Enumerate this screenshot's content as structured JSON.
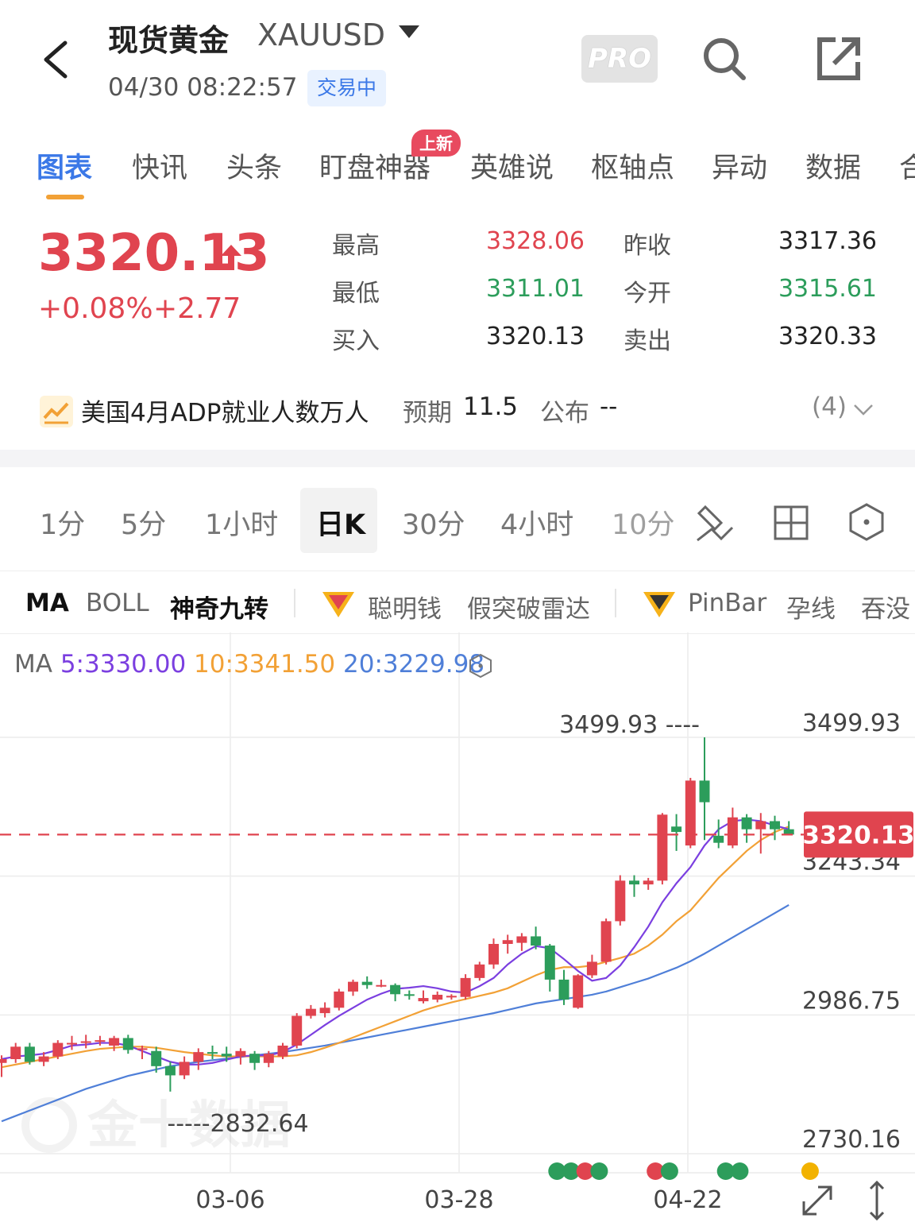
{
  "header": {
    "title": "现货黄金",
    "symbol": "XAUUSD",
    "datetime": "04/30 08:22:57",
    "status": "交易中",
    "pro_label": "PRO"
  },
  "tabs": [
    {
      "label": "图表"
    },
    {
      "label": "快讯"
    },
    {
      "label": "头条"
    },
    {
      "label": "盯盘神器",
      "badge": "上新"
    },
    {
      "label": "英雄说"
    },
    {
      "label": "枢轴点"
    },
    {
      "label": "异动"
    },
    {
      "label": "数据"
    },
    {
      "label": "合"
    }
  ],
  "quote": {
    "price": "3320.13",
    "change_pct": "+0.08%",
    "change": "+2.77",
    "high_label": "最高",
    "high": "3328.06",
    "prev_close_label": "昨收",
    "prev_close": "3317.36",
    "low_label": "最低",
    "low": "3311.01",
    "open_label": "今开",
    "open": "3315.61",
    "bid_label": "买入",
    "bid": "3320.13",
    "ask_label": "卖出",
    "ask": "3320.33"
  },
  "event": {
    "title": "美国4月ADP就业人数万人",
    "forecast_label": "预期",
    "forecast": "11.5",
    "actual_label": "公布",
    "actual": "--",
    "count": "(4)"
  },
  "periods": [
    "1分",
    "5分",
    "1小时",
    "日K",
    "30分",
    "4小时",
    "10分"
  ],
  "indicators": [
    "MA",
    "BOLL",
    "神奇九转",
    "聪明钱",
    "假突破雷达",
    "PinBar",
    "孕线",
    "吞没"
  ],
  "ma": {
    "label": "MA",
    "ma5": "5:3330.00",
    "ma10": "10:3341.50",
    "ma20": "20:3229.98",
    "colors": {
      "ma5": "#7b3fe0",
      "ma10": "#f2a136",
      "ma20": "#4f7fd8"
    }
  },
  "chart_data": {
    "type": "candlestick",
    "y_labels": [
      "3499.93",
      "3243.34",
      "2986.75",
      "2730.16"
    ],
    "ylim": [
      2730.16,
      3499.93
    ],
    "x_labels": [
      "03-06",
      "03-28",
      "04-22"
    ],
    "last_price_tag": "3320.13",
    "max_annotation": "3499.93",
    "min_annotation": "2832.64",
    "watermark": "金十数据",
    "colors": {
      "up": "#e0444f",
      "down": "#2c9d5b"
    },
    "candles": [
      {
        "o": 2898,
        "h": 2912,
        "l": 2872,
        "c": 2905
      },
      {
        "o": 2905,
        "h": 2935,
        "l": 2898,
        "c": 2928
      },
      {
        "o": 2928,
        "h": 2935,
        "l": 2895,
        "c": 2900
      },
      {
        "o": 2900,
        "h": 2918,
        "l": 2892,
        "c": 2910
      },
      {
        "o": 2910,
        "h": 2940,
        "l": 2905,
        "c": 2935
      },
      {
        "o": 2935,
        "h": 2948,
        "l": 2922,
        "c": 2935
      },
      {
        "o": 2935,
        "h": 2950,
        "l": 2925,
        "c": 2938
      },
      {
        "o": 2938,
        "h": 2948,
        "l": 2930,
        "c": 2940
      },
      {
        "o": 2930,
        "h": 2948,
        "l": 2920,
        "c": 2944
      },
      {
        "o": 2944,
        "h": 2950,
        "l": 2915,
        "c": 2922
      },
      {
        "o": 2922,
        "h": 2930,
        "l": 2905,
        "c": 2925
      },
      {
        "o": 2920,
        "h": 2928,
        "l": 2880,
        "c": 2892
      },
      {
        "o": 2892,
        "h": 2900,
        "l": 2845,
        "c": 2875
      },
      {
        "o": 2875,
        "h": 2910,
        "l": 2868,
        "c": 2900
      },
      {
        "o": 2900,
        "h": 2925,
        "l": 2885,
        "c": 2918
      },
      {
        "o": 2918,
        "h": 2930,
        "l": 2905,
        "c": 2915
      },
      {
        "o": 2915,
        "h": 2928,
        "l": 2900,
        "c": 2910
      },
      {
        "o": 2910,
        "h": 2925,
        "l": 2895,
        "c": 2920
      },
      {
        "o": 2915,
        "h": 2920,
        "l": 2885,
        "c": 2898
      },
      {
        "o": 2898,
        "h": 2920,
        "l": 2890,
        "c": 2915
      },
      {
        "o": 2910,
        "h": 2935,
        "l": 2905,
        "c": 2930
      },
      {
        "o": 2930,
        "h": 2990,
        "l": 2925,
        "c": 2985
      },
      {
        "o": 2985,
        "h": 3005,
        "l": 2980,
        "c": 2998
      },
      {
        "o": 2990,
        "h": 3010,
        "l": 2982,
        "c": 3000
      },
      {
        "o": 3000,
        "h": 3035,
        "l": 2995,
        "c": 3030
      },
      {
        "o": 3030,
        "h": 3052,
        "l": 3022,
        "c": 3048
      },
      {
        "o": 3048,
        "h": 3058,
        "l": 3035,
        "c": 3042
      },
      {
        "o": 3042,
        "h": 3052,
        "l": 3038,
        "c": 3042
      },
      {
        "o": 3042,
        "h": 3045,
        "l": 3012,
        "c": 3025
      },
      {
        "o": 3025,
        "h": 3032,
        "l": 3015,
        "c": 3022
      },
      {
        "o": 3012,
        "h": 3032,
        "l": 3008,
        "c": 3018
      },
      {
        "o": 3015,
        "h": 3030,
        "l": 3010,
        "c": 3024
      },
      {
        "o": 3020,
        "h": 3025,
        "l": 3015,
        "c": 3022
      },
      {
        "o": 3020,
        "h": 3062,
        "l": 3015,
        "c": 3055
      },
      {
        "o": 3055,
        "h": 3085,
        "l": 3050,
        "c": 3080
      },
      {
        "o": 3080,
        "h": 3128,
        "l": 3072,
        "c": 3118
      },
      {
        "o": 3118,
        "h": 3135,
        "l": 3100,
        "c": 3125
      },
      {
        "o": 3120,
        "h": 3138,
        "l": 3105,
        "c": 3132
      },
      {
        "o": 3132,
        "h": 3150,
        "l": 3108,
        "c": 3115
      },
      {
        "o": 3115,
        "h": 3118,
        "l": 3030,
        "c": 3052
      },
      {
        "o": 3052,
        "h": 3070,
        "l": 3005,
        "c": 3015
      },
      {
        "o": 3000,
        "h": 3062,
        "l": 2998,
        "c": 3060
      },
      {
        "o": 3060,
        "h": 3098,
        "l": 3055,
        "c": 3085
      },
      {
        "o": 3085,
        "h": 3165,
        "l": 3080,
        "c": 3160
      },
      {
        "o": 3160,
        "h": 3245,
        "l": 3152,
        "c": 3235
      },
      {
        "o": 3235,
        "h": 3245,
        "l": 3205,
        "c": 3228
      },
      {
        "o": 3228,
        "h": 3240,
        "l": 3218,
        "c": 3235
      },
      {
        "o": 3235,
        "h": 3360,
        "l": 3228,
        "c": 3357
      },
      {
        "o": 3335,
        "h": 3358,
        "l": 3290,
        "c": 3325
      },
      {
        "o": 3300,
        "h": 3425,
        "l": 3295,
        "c": 3420
      },
      {
        "o": 3420,
        "h": 3499.93,
        "l": 3310,
        "c": 3380
      },
      {
        "o": 3318,
        "h": 3348,
        "l": 3295,
        "c": 3305
      },
      {
        "o": 3300,
        "h": 3370,
        "l": 3295,
        "c": 3352
      },
      {
        "o": 3352,
        "h": 3358,
        "l": 3305,
        "c": 3330
      },
      {
        "o": 3330,
        "h": 3360,
        "l": 3285,
        "c": 3345
      },
      {
        "o": 3345,
        "h": 3355,
        "l": 3310,
        "c": 3330
      },
      {
        "o": 3330,
        "h": 3345,
        "l": 3322,
        "c": 3320.13
      }
    ],
    "ma5": [
      2905,
      2910,
      2912,
      2915,
      2922,
      2930,
      2932,
      2935,
      2935,
      2930,
      2920,
      2910,
      2900,
      2895,
      2895,
      2898,
      2904,
      2910,
      2912,
      2912,
      2918,
      2932,
      2950,
      2968,
      2985,
      3000,
      3015,
      3026,
      3035,
      3037,
      3040,
      3036,
      3030,
      3028,
      3040,
      3055,
      3080,
      3100,
      3114,
      3110,
      3090,
      3068,
      3050,
      3055,
      3078,
      3112,
      3150,
      3195,
      3230,
      3260,
      3300,
      3330,
      3345,
      3348,
      3345,
      3337,
      3330
    ],
    "ma10": [
      2890,
      2895,
      2900,
      2905,
      2910,
      2915,
      2920,
      2924,
      2926,
      2928,
      2928,
      2926,
      2922,
      2918,
      2915,
      2912,
      2910,
      2910,
      2910,
      2910,
      2910,
      2912,
      2918,
      2926,
      2935,
      2945,
      2955,
      2965,
      2975,
      2985,
      2995,
      3003,
      3010,
      3016,
      3022,
      3028,
      3036,
      3048,
      3060,
      3070,
      3075,
      3075,
      3078,
      3085,
      3092,
      3100,
      3115,
      3135,
      3160,
      3180,
      3210,
      3240,
      3265,
      3290,
      3310,
      3325,
      3335
    ],
    "ma20": [
      2790,
      2800,
      2810,
      2820,
      2830,
      2840,
      2850,
      2858,
      2866,
      2874,
      2880,
      2886,
      2892,
      2896,
      2900,
      2903,
      2906,
      2909,
      2912,
      2915,
      2918,
      2922,
      2926,
      2930,
      2935,
      2940,
      2945,
      2950,
      2955,
      2960,
      2965,
      2970,
      2975,
      2980,
      2985,
      2990,
      2996,
      3002,
      3008,
      3012,
      3016,
      3020,
      3024,
      3030,
      3038,
      3046,
      3054,
      3064,
      3074,
      3086,
      3100,
      3115,
      3130,
      3145,
      3160,
      3175,
      3190
    ],
    "signal_dots": [
      {
        "index": 39,
        "color": "#2c9d5b"
      },
      {
        "index": 40,
        "color": "#2c9d5b"
      },
      {
        "index": 41,
        "color": "#e0444f"
      },
      {
        "index": 42,
        "color": "#2c9d5b"
      },
      {
        "index": 46,
        "color": "#e0444f"
      },
      {
        "index": 47,
        "color": "#2c9d5b"
      },
      {
        "index": 51,
        "color": "#2c9d5b"
      },
      {
        "index": 52,
        "color": "#2c9d5b"
      },
      {
        "index": 57,
        "color": "#f2b200"
      }
    ]
  }
}
